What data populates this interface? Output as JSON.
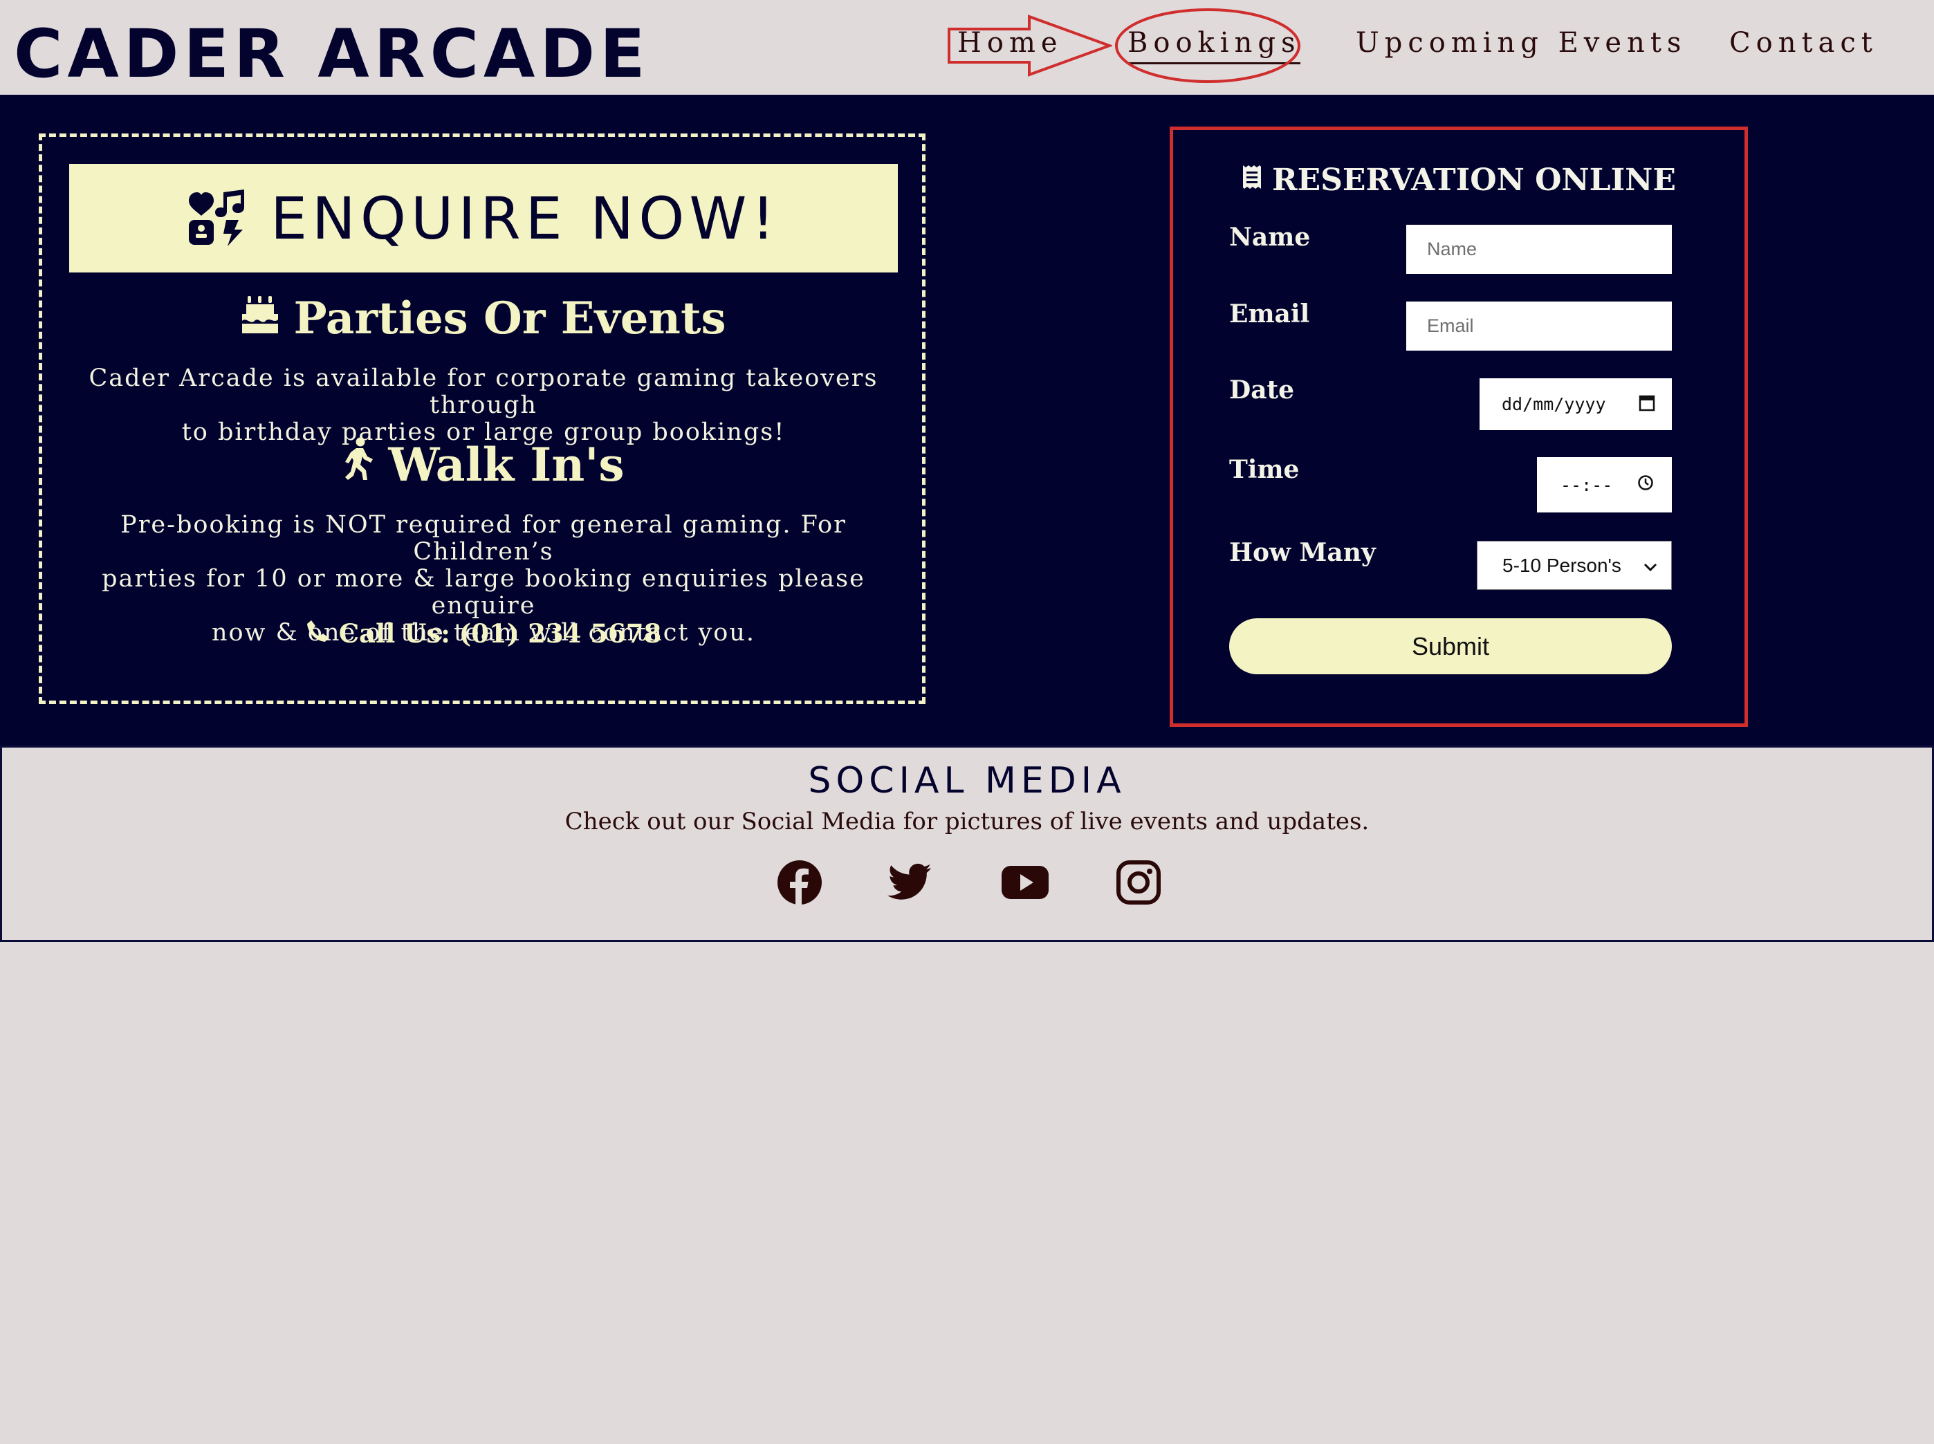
{
  "header": {
    "logo": "CADER ARCADE",
    "nav": {
      "home": "Home",
      "bookings": "Bookings",
      "upcoming": "Upcoming Events",
      "contact": "Contact"
    }
  },
  "enquire": {
    "title": "ENQUIRE NOW!",
    "icon": "gamepad-music-icon",
    "parties": {
      "heading": "Parties Or Events",
      "icon": "birthday-cake-icon",
      "text_lines": [
        "Cader Arcade is available for corporate gaming takeovers through",
        "to birthday parties or large group bookings!"
      ]
    },
    "walkin": {
      "heading": "Walk In's",
      "icon": "walking-person-icon",
      "text_lines": [
        "Pre-booking is NOT required for general gaming. For Children’s",
        "parties for 10 or more & large booking enquiries please enquire",
        "now & one of the team will contact you."
      ]
    },
    "call": "Call Us: (01) 234 5678",
    "call_icon": "phone-icon"
  },
  "reservation": {
    "title": "RESERVATION ONLINE",
    "title_icon": "receipt-icon",
    "labels": {
      "name": "Name",
      "email": "Email",
      "date": "Date",
      "time": "Time",
      "how_many": "How Many"
    },
    "placeholders": {
      "name": "Name",
      "email": "Email",
      "date": "dd/mm/yyyy",
      "time": "--:--"
    },
    "how_many_selected": "5-10 Person's",
    "submit": "Submit"
  },
  "social": {
    "title": "SOCIAL MEDIA",
    "text": "Check out our Social Media for pictures of live events and updates.",
    "icons": [
      "facebook-icon",
      "twitter-icon",
      "youtube-icon",
      "instagram-icon"
    ]
  },
  "colors": {
    "navy": "#02022f",
    "cream": "#f3f3c3",
    "page_bg": "#e0dadb",
    "annotation_red": "#d02d2d"
  }
}
